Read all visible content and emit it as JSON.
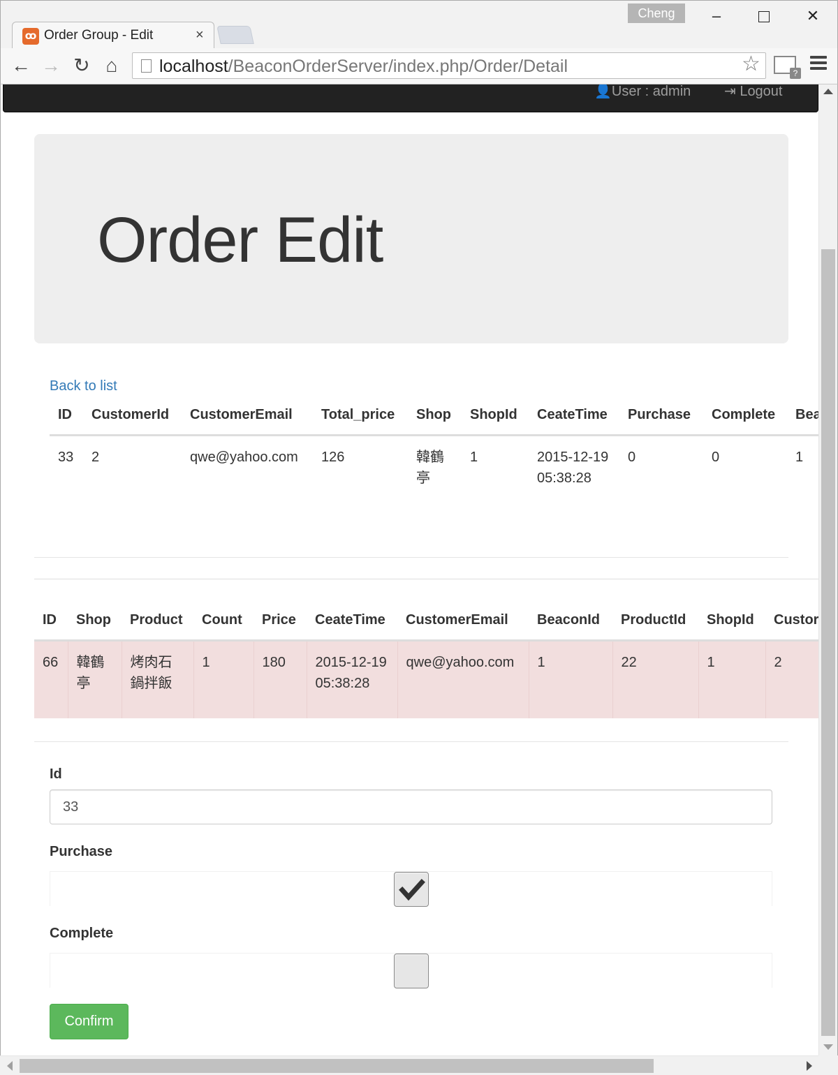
{
  "browser": {
    "profile_name": "Cheng",
    "tab_title": "Order Group - Edit",
    "tab_close": "×",
    "url_host": "localhost",
    "url_path": "/BeaconOrderServer/index.php/Order/Detail",
    "win_minimize": "–",
    "win_close": "✕",
    "nav_back": "←",
    "nav_forward": "→",
    "nav_reload": "↻",
    "nav_home": "⌂",
    "star": "☆",
    "icons": [
      "xampp-favicon-icon",
      "page-icon",
      "star-icon",
      "gmail-icon",
      "menu-icon"
    ]
  },
  "navbar": {
    "user_text": "👤User : admin",
    "logout_text": "⇥ Logout"
  },
  "jumbotron": {
    "title": "Order Edit"
  },
  "back_link": "Back to list",
  "order_table": {
    "headers": [
      "ID",
      "CustomerId",
      "CustomerEmail",
      "Total_price",
      "Shop",
      "ShopId",
      "CeateTime",
      "Purchase",
      "Complete",
      "Bea"
    ],
    "row": [
      "33",
      "2",
      "qwe@yahoo.com",
      "126",
      "韓鶴亭",
      "1",
      "2015-12-19 05:38:28",
      "0",
      "0",
      "1"
    ]
  },
  "detail_table": {
    "headers": [
      "ID",
      "Shop",
      "Product",
      "Count",
      "Price",
      "CeateTime",
      "CustomerEmail",
      "BeaconId",
      "ProductId",
      "ShopId",
      "Custor"
    ],
    "row": [
      "66",
      "韓鶴亭",
      "烤肉石鍋拌飯",
      "1",
      "180",
      "2015-12-19 05:38:28",
      "qwe@yahoo.com",
      "1",
      "22",
      "1",
      "2"
    ]
  },
  "form": {
    "id_label": "Id",
    "id_value": "33",
    "purchase_label": "Purchase",
    "purchase_checked": true,
    "complete_label": "Complete",
    "complete_checked": false,
    "confirm_label": "Confirm"
  },
  "colors": {
    "navbar_bg": "#222222",
    "jumbotron_bg": "#eeeeee",
    "link": "#337ab7",
    "danger_row": "#f2dede",
    "success_button": "#5cb85c"
  }
}
